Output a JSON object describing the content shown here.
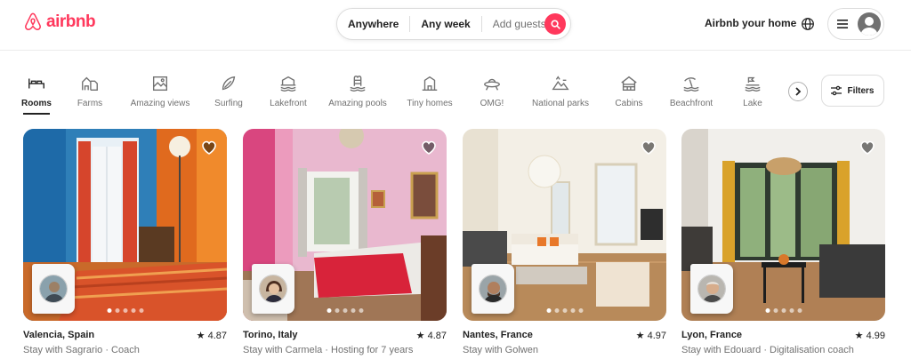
{
  "brand": {
    "name": "airbnb",
    "color": "#ff385c"
  },
  "search": {
    "where": "Anywhere",
    "when": "Any week",
    "guests": "Add guests"
  },
  "header": {
    "host_link": "Airbnb your home"
  },
  "categories": [
    {
      "label": "Rooms",
      "icon": "bed-icon"
    },
    {
      "label": "Farms",
      "icon": "barn-icon"
    },
    {
      "label": "Amazing views",
      "icon": "picture-icon"
    },
    {
      "label": "Surfing",
      "icon": "surfboard-icon"
    },
    {
      "label": "Lakefront",
      "icon": "lake-house-icon"
    },
    {
      "label": "Amazing pools",
      "icon": "pool-icon"
    },
    {
      "label": "Tiny homes",
      "icon": "tiny-home-icon"
    },
    {
      "label": "OMG!",
      "icon": "ufo-icon"
    },
    {
      "label": "National parks",
      "icon": "mountain-icon"
    },
    {
      "label": "Cabins",
      "icon": "cabin-icon"
    },
    {
      "label": "Beachfront",
      "icon": "beach-icon"
    },
    {
      "label": "Lake",
      "icon": "lake-icon"
    }
  ],
  "filters_label": "Filters",
  "listings": [
    {
      "location": "Valencia, Spain",
      "rating": "4.87",
      "subtitle": "Stay with Sagrario · Coach"
    },
    {
      "location": "Torino, Italy",
      "rating": "4.87",
      "subtitle": "Stay with Carmela · Hosting for 7 years"
    },
    {
      "location": "Nantes, France",
      "rating": "4.97",
      "subtitle": "Stay with Golwen"
    },
    {
      "location": "Lyon, France",
      "rating": "4.99",
      "subtitle": "Stay with Edouard · Digitalisation coach"
    }
  ]
}
